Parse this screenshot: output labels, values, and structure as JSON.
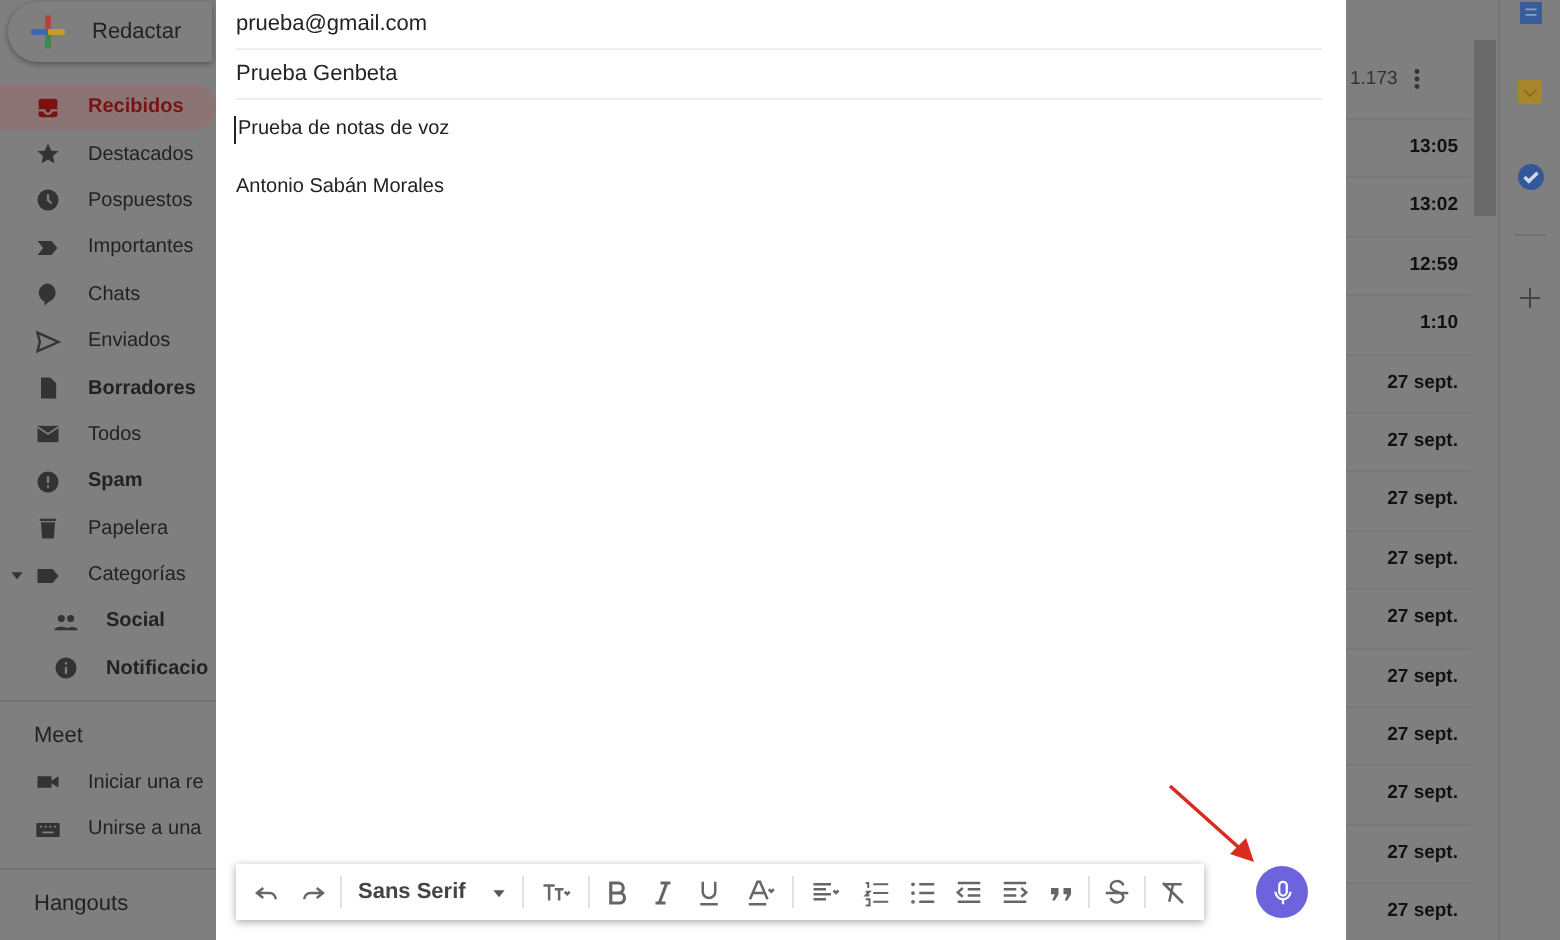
{
  "sidebar": {
    "compose": "Redactar",
    "items": [
      {
        "label": "Recibidos",
        "bold": true,
        "selected": true
      },
      {
        "label": "Destacados",
        "bold": false,
        "selected": false
      },
      {
        "label": "Pospuestos",
        "bold": false,
        "selected": false
      },
      {
        "label": "Importantes",
        "bold": false,
        "selected": false
      },
      {
        "label": "Chats",
        "bold": false,
        "selected": false
      },
      {
        "label": "Enviados",
        "bold": false,
        "selected": false
      },
      {
        "label": "Borradores",
        "bold": true,
        "selected": false
      },
      {
        "label": "Todos",
        "bold": false,
        "selected": false
      },
      {
        "label": "Spam",
        "bold": true,
        "selected": false
      },
      {
        "label": "Papelera",
        "bold": false,
        "selected": false
      },
      {
        "label": "Categorías",
        "bold": false,
        "selected": false,
        "expanded": true,
        "children": [
          {
            "label": "Social",
            "bold": true,
            "selected": false
          },
          {
            "label": "Notificacio",
            "bold": true,
            "selected": false
          }
        ]
      }
    ],
    "meet": {
      "title": "Meet",
      "items": [
        {
          "label": "Iniciar una re"
        },
        {
          "label": "Unirse a una"
        }
      ]
    },
    "hangouts": {
      "title": "Hangouts"
    }
  },
  "compose": {
    "to": "prueba@gmail.com",
    "subject": "Prueba Genbeta",
    "body": "Prueba de notas de voz",
    "signature": "Antonio Sabán Morales",
    "toolbar": {
      "font": "Sans Serif"
    }
  },
  "mail_list": {
    "count": "1.173",
    "times": [
      "13:05",
      "13:02",
      "12:59",
      "1:10",
      "27 sept.",
      "27 sept.",
      "27 sept.",
      "27 sept.",
      "27 sept.",
      "27 sept.",
      "27 sept.",
      "27 sept.",
      "27 sept.",
      "27 sept."
    ]
  }
}
